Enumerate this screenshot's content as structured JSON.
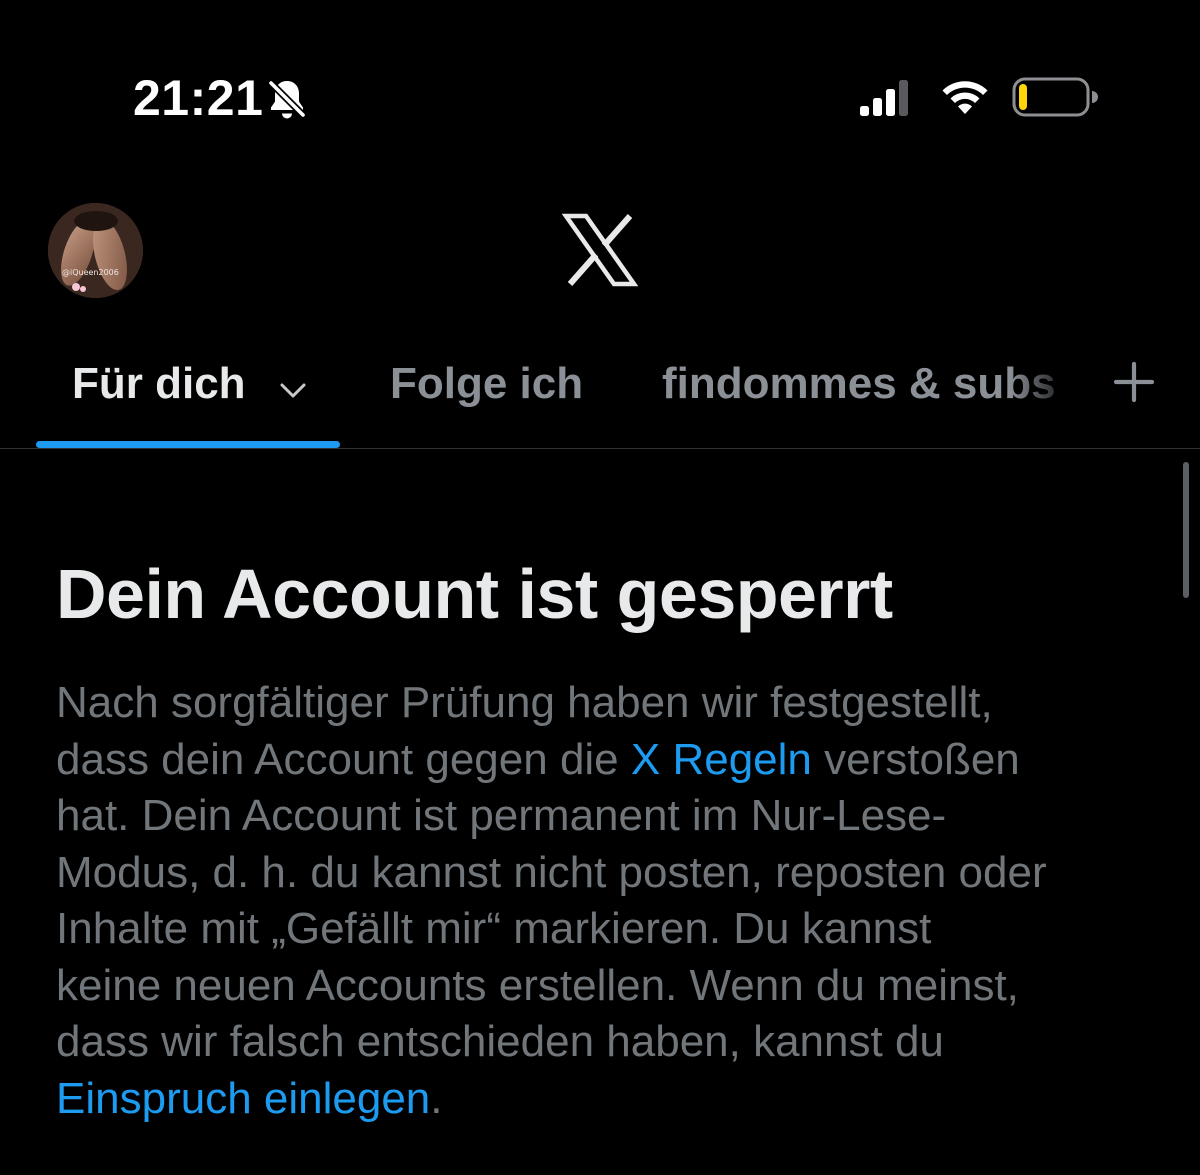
{
  "status_bar": {
    "time": "21:21",
    "icons": {
      "mute": "bell-off-icon",
      "signal": "signal-icon",
      "wifi": "wifi-icon",
      "battery": "battery-icon"
    },
    "battery_level": 0.12,
    "battery_color": "#ffd60a"
  },
  "header": {
    "avatar_watermark": "@iQueen2006",
    "logo_icon": "x-logo-icon"
  },
  "tabs": {
    "items": [
      {
        "label": "Für dich",
        "active": true,
        "icon": "chevron-down-icon"
      },
      {
        "label": "Folge ich",
        "active": false
      },
      {
        "label": "findommes & subs",
        "active": false
      }
    ],
    "add_icon": "plus-icon"
  },
  "notice": {
    "title": "Dein Account ist gesperrt",
    "lines": [
      {
        "text": "Nach sorgfältiger Prüfung haben wir festgestellt,"
      },
      {
        "before": "dass dein Account gegen die ",
        "link": "X Regeln",
        "after": " verstoßen"
      },
      {
        "text": "hat. Dein Account ist permanent im Nur-Lese-"
      },
      {
        "text": "Modus, d. h. du kannst nicht posten, reposten oder"
      },
      {
        "text": "Inhalte mit „Gefällt mir“ markieren. Du kannst"
      },
      {
        "text": "keine neuen Accounts erstellen. Wenn du meinst,"
      },
      {
        "text": "dass wir falsch entschieden haben, kannst du"
      },
      {
        "before": "",
        "link": "Einspruch einlegen",
        "after": "."
      }
    ]
  },
  "colors": {
    "background": "#000000",
    "primary_text": "#e7e9ea",
    "secondary_text": "#71767b",
    "inactive_tab": "#8b9097",
    "accent": "#1d9bf0",
    "divider": "#2f3336"
  }
}
